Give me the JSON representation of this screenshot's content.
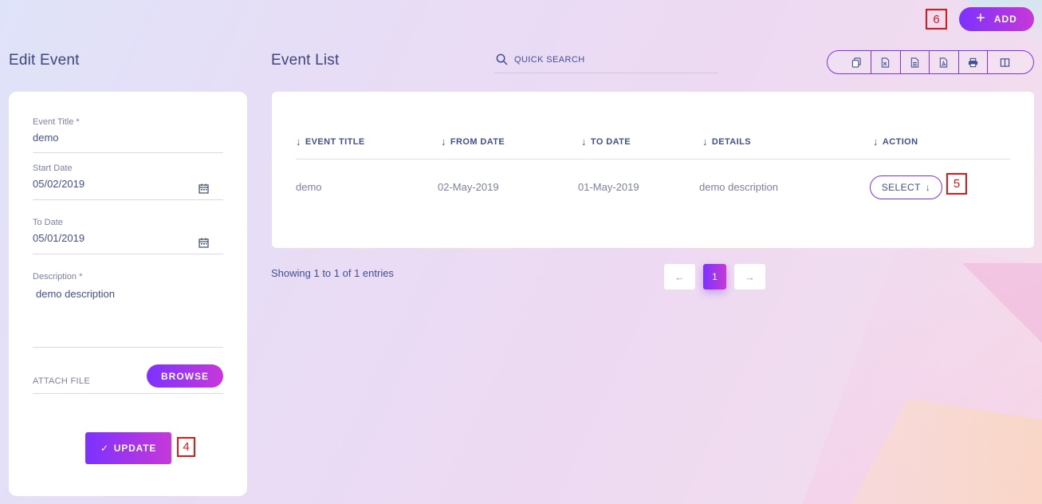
{
  "header": {
    "edit_title": "Edit Event",
    "list_title": "Event List",
    "add_label": "ADD",
    "search_placeholder": "QUICK SEARCH"
  },
  "toolbar": {
    "icons": [
      "copy-icon",
      "excel-icon",
      "csv-icon",
      "pdf-icon",
      "print-icon",
      "columns-icon"
    ]
  },
  "form": {
    "title_label": "Event Title *",
    "title_value": "demo",
    "start_label": "Start Date",
    "start_value": "05/02/2019",
    "to_label": "To Date",
    "to_value": "05/01/2019",
    "desc_label": "Description *",
    "desc_value": "demo description",
    "attach_label": "ATTACH FILE",
    "browse_label": "BROWSE",
    "update_label": "UPDATE"
  },
  "table": {
    "columns": [
      "EVENT TITLE",
      "FROM DATE",
      "TO DATE",
      "DETAILS",
      "ACTION"
    ],
    "rows": [
      {
        "title": "demo",
        "from": "02-May-2019",
        "to": "01-May-2019",
        "details": "demo description",
        "action": "SELECT"
      }
    ]
  },
  "pagination": {
    "info": "Showing 1 to 1 of 1 entries",
    "current": "1"
  },
  "markers": {
    "update": "4",
    "select": "5",
    "add": "6"
  },
  "colors": {
    "accent_start": "#7c32ff",
    "accent_end": "#c738d8",
    "text": "#415094",
    "marker": "#e21717"
  }
}
